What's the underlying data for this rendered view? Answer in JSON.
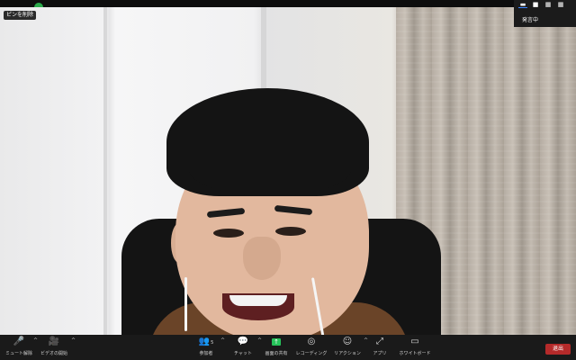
{
  "overlay": {
    "pin_label": "ピンを削除"
  },
  "view_switch": {
    "label": "発言中"
  },
  "toolbar": {
    "mute_label": "ミュート解除",
    "video_label": "ビデオの開始",
    "participants_label": "参加者",
    "participants_count": "5",
    "chat_label": "チャット",
    "share_label": "画面の共有",
    "record_label": "レコーディング",
    "reactions_label": "リアクション",
    "apps_label": "アプリ",
    "whiteboard_label": "ホワイトボード",
    "end_label": "退出"
  },
  "colors": {
    "share_green": "#26c35a",
    "end_red": "#b52a2a",
    "toolbar_bg": "#1a1a1a"
  },
  "icons": {
    "mute": "mic-muted-icon",
    "video": "camera-off-icon",
    "participants": "people-icon",
    "chat": "chat-bubble-icon",
    "share": "share-screen-icon",
    "record": "record-icon",
    "reactions": "emoji-icon",
    "apps": "apps-icon",
    "whiteboard": "whiteboard-icon"
  }
}
